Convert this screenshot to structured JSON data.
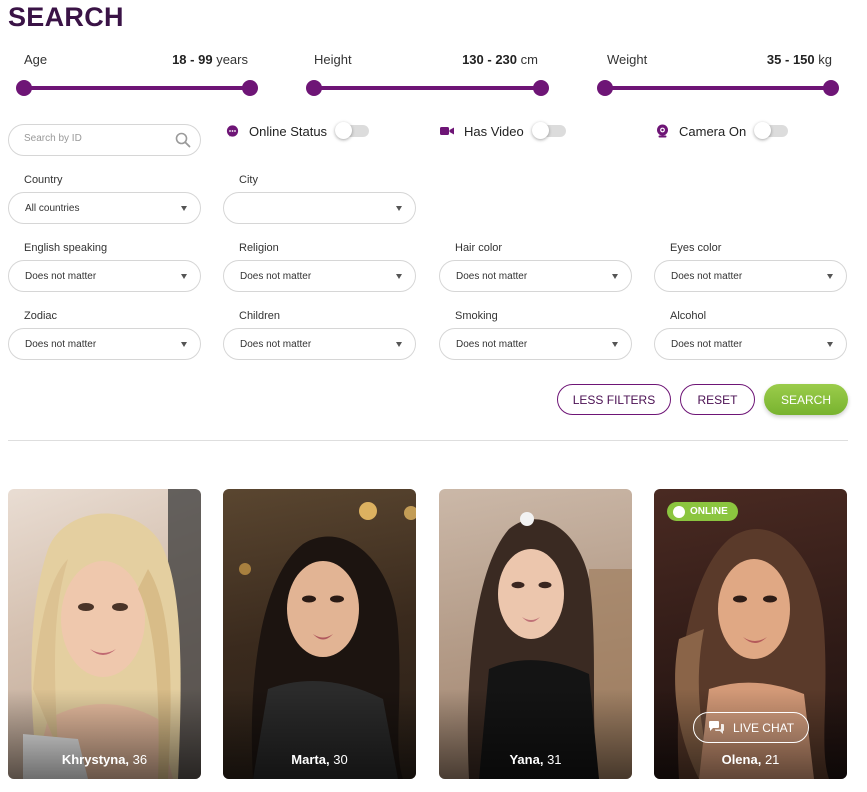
{
  "page": {
    "title": "SEARCH"
  },
  "ranges": {
    "age": {
      "label": "Age",
      "min": "18",
      "sep": " - ",
      "max": "99",
      "unit": "years"
    },
    "height": {
      "label": "Height",
      "min": "130",
      "sep": " - ",
      "max": "230",
      "unit": "cm"
    },
    "weight": {
      "label": "Weight",
      "min": "35",
      "sep": " - ",
      "max": "150",
      "unit": "kg"
    }
  },
  "search_id": {
    "placeholder": "Search by ID",
    "icon": "search-icon"
  },
  "toggles": {
    "online": {
      "label": "Online Status",
      "icon": "chat-bubble-icon",
      "on": false
    },
    "video": {
      "label": "Has Video",
      "icon": "video-camera-icon",
      "on": false
    },
    "camera": {
      "label": "Camera On",
      "icon": "webcam-icon",
      "on": false
    }
  },
  "filters": {
    "country": {
      "label": "Country",
      "value": "All countries"
    },
    "city": {
      "label": "City",
      "value": ""
    },
    "english": {
      "label": "English speaking",
      "value": "Does not matter"
    },
    "religion": {
      "label": "Religion",
      "value": "Does not matter"
    },
    "hair": {
      "label": "Hair color",
      "value": "Does not matter"
    },
    "eyes": {
      "label": "Eyes color",
      "value": "Does not matter"
    },
    "zodiac": {
      "label": "Zodiac",
      "value": "Does not matter"
    },
    "children": {
      "label": "Children",
      "value": "Does not matter"
    },
    "smoking": {
      "label": "Smoking",
      "value": "Does not matter"
    },
    "alcohol": {
      "label": "Alcohol",
      "value": "Does not matter"
    }
  },
  "buttons": {
    "less_filters": "LESS FILTERS",
    "reset": "RESET",
    "search": "SEARCH"
  },
  "profiles": [
    {
      "name": "Khrystyna,",
      "age": "36",
      "online": false
    },
    {
      "name": "Marta,",
      "age": "30",
      "online": false
    },
    {
      "name": "Yana,",
      "age": "31",
      "online": false
    },
    {
      "name": "Olena,",
      "age": "21",
      "online": true,
      "badge": "ONLINE",
      "live_chat": "LIVE CHAT"
    }
  ],
  "colors": {
    "brand": "#6e1576",
    "title": "#3a1346",
    "accent_green": "#8bc53f"
  }
}
